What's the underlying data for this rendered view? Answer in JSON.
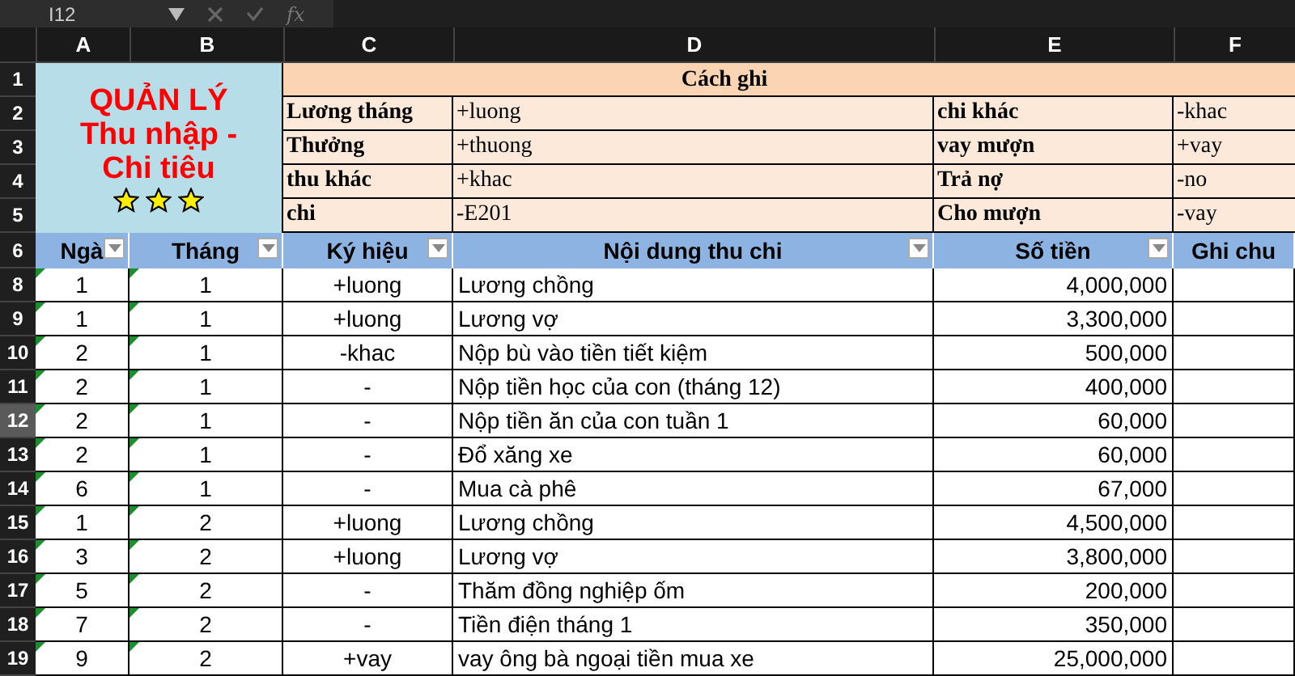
{
  "formula_bar": {
    "name_box": "I12",
    "fx": "fx"
  },
  "columns": [
    "A",
    "B",
    "C",
    "D",
    "E",
    "F"
  ],
  "title_block": {
    "lines": [
      "QUẢN LÝ",
      "Thu nhập -",
      "Chi tiêu"
    ],
    "stars": 3
  },
  "legend": {
    "heading_row": "1",
    "heading": "Cách ghi",
    "rows": [
      {
        "row": "2",
        "label_1": "Lương tháng",
        "code_1": "+luong",
        "label_2": "chi khác",
        "code_2": "-khac"
      },
      {
        "row": "3",
        "label_1": "Thưởng",
        "code_1": "+thuong",
        "label_2": "vay mượn",
        "code_2": "+vay"
      },
      {
        "row": "4",
        "label_1": "thu khác",
        "code_1": "+khac",
        "label_2": "Trả nợ",
        "code_2": "-no"
      },
      {
        "row": "5",
        "label_1": "chi",
        "code_1": "-E201",
        "label_2": "Cho mượn",
        "code_2": "-vay"
      }
    ]
  },
  "header_row": {
    "row": "6",
    "cells": [
      {
        "label": "Ngà",
        "filter": true
      },
      {
        "label": "Tháng",
        "filter": true
      },
      {
        "label": "Ký hiệu",
        "filter": true
      },
      {
        "label": "Nội dung thu chi",
        "filter": true
      },
      {
        "label": "Số tiền",
        "filter": true
      },
      {
        "label": "Ghi chu",
        "filter": false
      }
    ]
  },
  "rows": [
    {
      "row": "8",
      "selected": false,
      "flagged": true,
      "cells": [
        "1",
        "1",
        "+luong",
        "Lương chồng",
        "4,000,000"
      ]
    },
    {
      "row": "9",
      "selected": false,
      "flagged": true,
      "cells": [
        "1",
        "1",
        "+luong",
        "Lương vợ",
        "3,300,000"
      ]
    },
    {
      "row": "10",
      "selected": false,
      "flagged": true,
      "cells": [
        "2",
        "1",
        "-khac",
        "Nộp bù vào tiền tiết kiệm",
        "500,000"
      ]
    },
    {
      "row": "11",
      "selected": false,
      "flagged": true,
      "cells": [
        "2",
        "1",
        "-",
        "Nộp tiền học của con (tháng 12)",
        "400,000"
      ]
    },
    {
      "row": "12",
      "selected": true,
      "flagged": true,
      "cells": [
        "2",
        "1",
        "-",
        "Nộp tiền ăn của con tuần 1",
        "60,000"
      ]
    },
    {
      "row": "13",
      "selected": false,
      "flagged": true,
      "cells": [
        "2",
        "1",
        "-",
        "Đổ xăng xe",
        "60,000"
      ]
    },
    {
      "row": "14",
      "selected": false,
      "flagged": true,
      "cells": [
        "6",
        "1",
        "-",
        "Mua cà phê",
        "67,000"
      ]
    },
    {
      "row": "15",
      "selected": false,
      "flagged": true,
      "cells": [
        "1",
        "2",
        "+luong",
        "Lương chồng",
        "4,500,000"
      ]
    },
    {
      "row": "16",
      "selected": false,
      "flagged": true,
      "cells": [
        "3",
        "2",
        "+luong",
        "Lương vợ",
        "3,800,000"
      ]
    },
    {
      "row": "17",
      "selected": false,
      "flagged": true,
      "cells": [
        "5",
        "2",
        "-",
        "Thăm đồng nghiệp ốm",
        "200,000"
      ]
    },
    {
      "row": "18",
      "selected": false,
      "flagged": true,
      "cells": [
        "7",
        "2",
        "-",
        "Tiền điện tháng 1",
        "350,000"
      ]
    },
    {
      "row": "19",
      "selected": false,
      "flagged": true,
      "cells": [
        "9",
        "2",
        "+vay",
        "vay ông bà ngoại tiền mua xe",
        "25,000,000"
      ]
    }
  ]
}
